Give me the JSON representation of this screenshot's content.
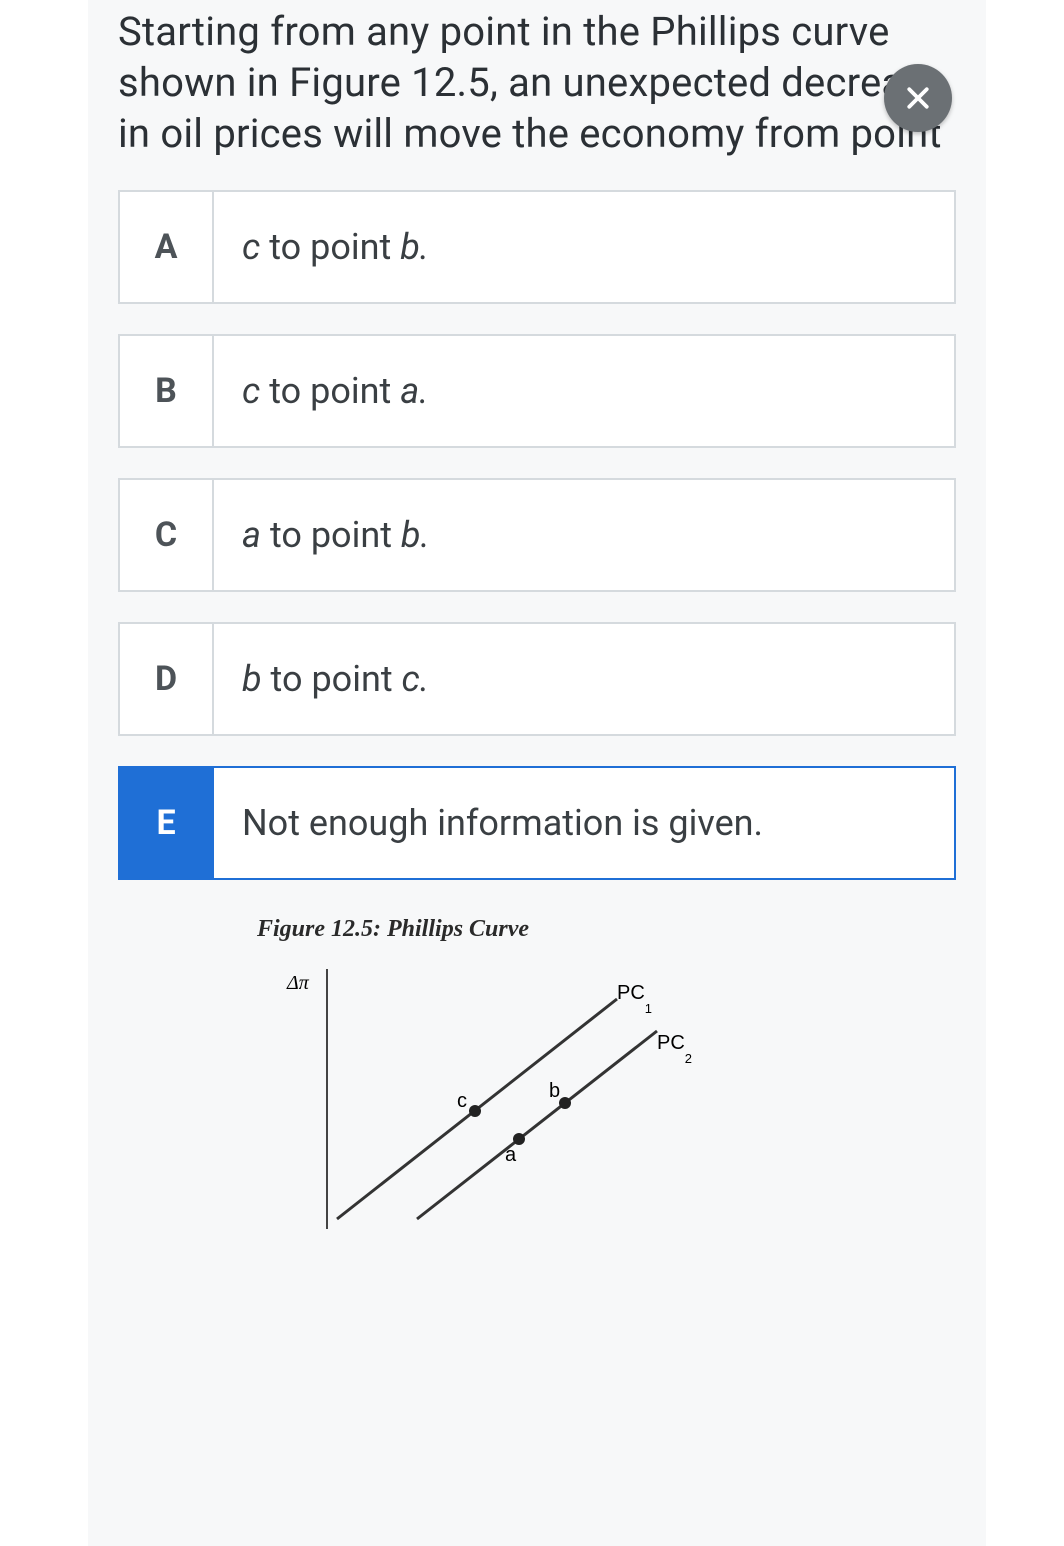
{
  "question": "Starting from any point in the Phillips curve shown in Figure 12.5, an unexpected decrease in oil prices will move the economy from point",
  "close_icon": "close",
  "options": [
    {
      "letter": "A",
      "prefix": "c",
      "mid": " to point ",
      "suffix": "b.",
      "selected": false
    },
    {
      "letter": "B",
      "prefix": "c",
      "mid": " to point ",
      "suffix": "a.",
      "selected": false
    },
    {
      "letter": "C",
      "prefix": "a",
      "mid": " to point ",
      "suffix": "b.",
      "selected": false
    },
    {
      "letter": "D",
      "prefix": "b",
      "mid": " to point ",
      "suffix": "c.",
      "selected": false
    },
    {
      "letter": "E",
      "plain": "Not enough information is given.",
      "selected": true
    }
  ],
  "figure": {
    "title": "Figure 12.5: Phillips Curve",
    "y_axis": "Δπ",
    "curves": [
      {
        "name": "PC",
        "sub": "1"
      },
      {
        "name": "PC",
        "sub": "2"
      }
    ],
    "points": [
      "a",
      "b",
      "c"
    ]
  }
}
